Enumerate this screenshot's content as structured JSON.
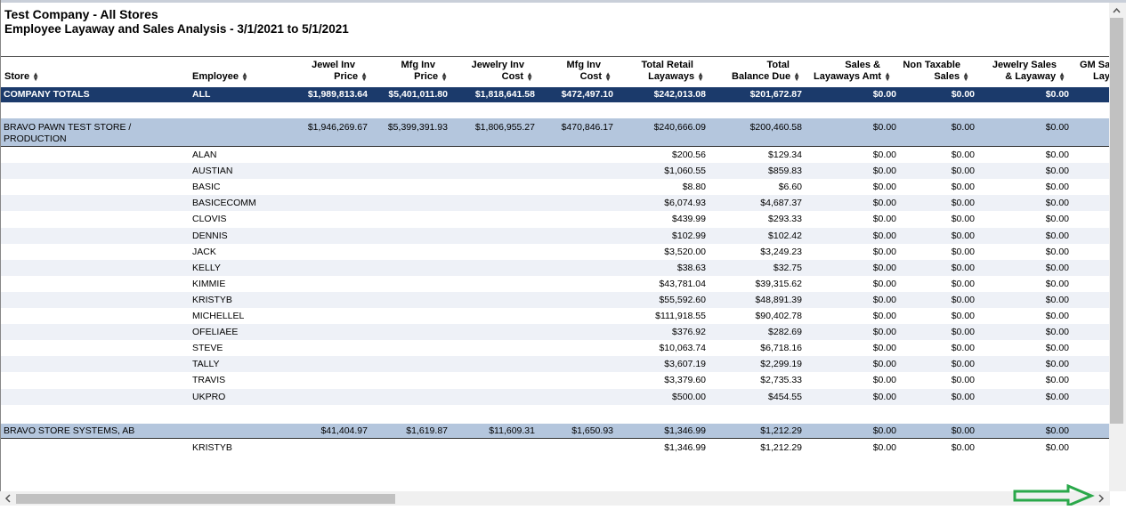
{
  "report": {
    "title": "Test Company - All Stores",
    "subtitle": "Employee Layaway and Sales Analysis - 3/1/2021 to 5/1/2021"
  },
  "columns": {
    "store": "Store",
    "employee": "Employee",
    "jewel_inv_price_1": "Jewel Inv",
    "jewel_inv_price_2": "Price",
    "mfg_inv_price_1": "Mfg Inv",
    "mfg_inv_price_2": "Price",
    "jewelry_inv_cost_1": "Jewelry Inv",
    "jewelry_inv_cost_2": "Cost",
    "mfg_inv_cost_1": "Mfg Inv",
    "mfg_inv_cost_2": "Cost",
    "total_retail_1": "Total Retail",
    "total_retail_2": "Layaways",
    "total_balance_1": "Total",
    "total_balance_2": "Balance Due",
    "sales_layaways_1": "Sales &",
    "sales_layaways_2": "Layaways Amt",
    "non_taxable_1": "Non Taxable",
    "non_taxable_2": "Sales",
    "jewelry_sales_1": "Jewelry Sales",
    "jewelry_sales_2": "& Layaway",
    "gm_1": "GM Sa",
    "gm_2": "Lay"
  },
  "company_totals": {
    "store": "COMPANY TOTALS",
    "employee": "ALL",
    "jewel_inv_price": "$1,989,813.64",
    "mfg_inv_price": "$5,401,011.80",
    "jewelry_inv_cost": "$1,818,641.58",
    "mfg_inv_cost": "$472,497.10",
    "total_retail": "$242,013.08",
    "total_balance": "$201,672.87",
    "sales_layaways": "$0.00",
    "non_taxable": "$0.00",
    "jewelry_sales": "$0.00"
  },
  "stores": [
    {
      "name_1": "BRAVO PAWN TEST STORE /",
      "name_2": "PRODUCTION",
      "jewel_inv_price": "$1,946,269.67",
      "mfg_inv_price": "$5,399,391.93",
      "jewelry_inv_cost": "$1,806,955.27",
      "mfg_inv_cost": "$470,846.17",
      "total_retail": "$240,666.09",
      "total_balance": "$200,460.58",
      "sales_layaways": "$0.00",
      "non_taxable": "$0.00",
      "jewelry_sales": "$0.00",
      "employees": [
        {
          "name": "ALAN",
          "total_retail": "$200.56",
          "total_balance": "$129.34",
          "sales_layaways": "$0.00",
          "non_taxable": "$0.00",
          "jewelry_sales": "$0.00"
        },
        {
          "name": "AUSTIAN",
          "total_retail": "$1,060.55",
          "total_balance": "$859.83",
          "sales_layaways": "$0.00",
          "non_taxable": "$0.00",
          "jewelry_sales": "$0.00"
        },
        {
          "name": "BASIC",
          "total_retail": "$8.80",
          "total_balance": "$6.60",
          "sales_layaways": "$0.00",
          "non_taxable": "$0.00",
          "jewelry_sales": "$0.00"
        },
        {
          "name": "BASICECOMM",
          "total_retail": "$6,074.93",
          "total_balance": "$4,687.37",
          "sales_layaways": "$0.00",
          "non_taxable": "$0.00",
          "jewelry_sales": "$0.00"
        },
        {
          "name": "CLOVIS",
          "total_retail": "$439.99",
          "total_balance": "$293.33",
          "sales_layaways": "$0.00",
          "non_taxable": "$0.00",
          "jewelry_sales": "$0.00"
        },
        {
          "name": "DENNIS",
          "total_retail": "$102.99",
          "total_balance": "$102.42",
          "sales_layaways": "$0.00",
          "non_taxable": "$0.00",
          "jewelry_sales": "$0.00"
        },
        {
          "name": "JACK",
          "total_retail": "$3,520.00",
          "total_balance": "$3,249.23",
          "sales_layaways": "$0.00",
          "non_taxable": "$0.00",
          "jewelry_sales": "$0.00"
        },
        {
          "name": "KELLY",
          "total_retail": "$38.63",
          "total_balance": "$32.75",
          "sales_layaways": "$0.00",
          "non_taxable": "$0.00",
          "jewelry_sales": "$0.00"
        },
        {
          "name": "KIMMIE",
          "total_retail": "$43,781.04",
          "total_balance": "$39,315.62",
          "sales_layaways": "$0.00",
          "non_taxable": "$0.00",
          "jewelry_sales": "$0.00"
        },
        {
          "name": "KRISTYB",
          "total_retail": "$55,592.60",
          "total_balance": "$48,891.39",
          "sales_layaways": "$0.00",
          "non_taxable": "$0.00",
          "jewelry_sales": "$0.00"
        },
        {
          "name": "MICHELLEL",
          "total_retail": "$111,918.55",
          "total_balance": "$90,402.78",
          "sales_layaways": "$0.00",
          "non_taxable": "$0.00",
          "jewelry_sales": "$0.00"
        },
        {
          "name": "OFELIAEE",
          "total_retail": "$376.92",
          "total_balance": "$282.69",
          "sales_layaways": "$0.00",
          "non_taxable": "$0.00",
          "jewelry_sales": "$0.00"
        },
        {
          "name": "STEVE",
          "total_retail": "$10,063.74",
          "total_balance": "$6,718.16",
          "sales_layaways": "$0.00",
          "non_taxable": "$0.00",
          "jewelry_sales": "$0.00"
        },
        {
          "name": "TALLY",
          "total_retail": "$3,607.19",
          "total_balance": "$2,299.19",
          "sales_layaways": "$0.00",
          "non_taxable": "$0.00",
          "jewelry_sales": "$0.00"
        },
        {
          "name": "TRAVIS",
          "total_retail": "$3,379.60",
          "total_balance": "$2,735.33",
          "sales_layaways": "$0.00",
          "non_taxable": "$0.00",
          "jewelry_sales": "$0.00"
        },
        {
          "name": "UKPRO",
          "total_retail": "$500.00",
          "total_balance": "$454.55",
          "sales_layaways": "$0.00",
          "non_taxable": "$0.00",
          "jewelry_sales": "$0.00"
        }
      ]
    },
    {
      "name_1": "BRAVO STORE SYSTEMS, AB",
      "name_2": "",
      "jewel_inv_price": "$41,404.97",
      "mfg_inv_price": "$1,619.87",
      "jewelry_inv_cost": "$11,609.31",
      "mfg_inv_cost": "$1,650.93",
      "total_retail": "$1,346.99",
      "total_balance": "$1,212.29",
      "sales_layaways": "$0.00",
      "non_taxable": "$0.00",
      "jewelry_sales": "$0.00",
      "employees": [
        {
          "name": "KRISTYB",
          "total_retail": "$1,346.99",
          "total_balance": "$1,212.29",
          "sales_layaways": "$0.00",
          "non_taxable": "$0.00",
          "jewelry_sales": "$0.00"
        }
      ]
    }
  ],
  "icons": {
    "sort": "sort-icon",
    "scroll_up": "chevron-up-icon",
    "scroll_left": "chevron-left-icon",
    "scroll_right": "chevron-right-icon",
    "annotation": "arrow-right-icon"
  },
  "colors": {
    "total_row_bg": "#1b3a6b",
    "store_row_bg": "#b4c6dd",
    "alt_row_bg": "#eef1f7",
    "annotation_arrow": "#2aa84a"
  }
}
